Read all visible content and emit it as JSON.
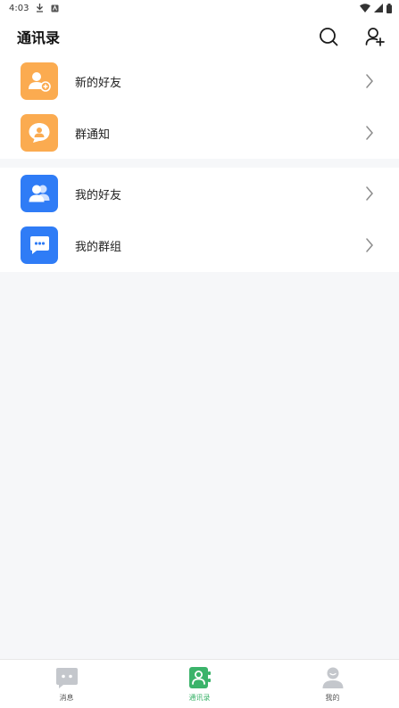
{
  "status_bar": {
    "time": "4:03"
  },
  "header": {
    "title": "通讯录"
  },
  "sections": [
    {
      "items": [
        {
          "label": "新的好友",
          "icon": "add-user-icon",
          "color": "#fbab50"
        },
        {
          "label": "群通知",
          "icon": "chat-bubble-user-icon",
          "color": "#fbab50"
        }
      ]
    },
    {
      "items": [
        {
          "label": "我的好友",
          "icon": "friends-icon",
          "color": "#2f7cf6"
        },
        {
          "label": "我的群组",
          "icon": "group-chat-icon",
          "color": "#2f7cf6"
        }
      ]
    }
  ],
  "tabs": [
    {
      "label": "消息",
      "icon": "message-icon",
      "active": false
    },
    {
      "label": "通讯录",
      "icon": "contacts-icon",
      "active": true
    },
    {
      "label": "我的",
      "icon": "profile-icon",
      "active": false
    }
  ],
  "colors": {
    "active_tab": "#3bb36a",
    "inactive_tab": "#c4c7cc",
    "accent_orange": "#fbab50",
    "accent_blue": "#2f7cf6"
  }
}
